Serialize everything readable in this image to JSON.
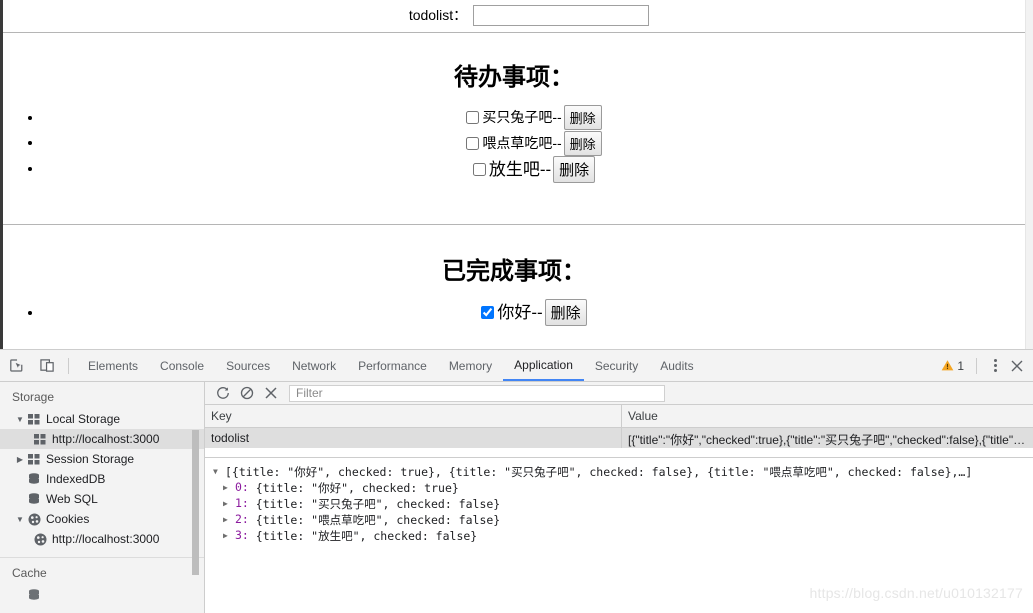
{
  "page": {
    "todolist_label": "todolist：",
    "todolist_input_value": "",
    "todolist_input_placeholder": "",
    "pending": {
      "heading": "待办事项：",
      "items": [
        {
          "title": "买只兔子吧--",
          "delete_label": "删除"
        },
        {
          "title": "喂点草吃吧--",
          "delete_label": "删除"
        },
        {
          "title": "放生吧--",
          "delete_label": "删除"
        }
      ]
    },
    "done": {
      "heading": "已完成事项：",
      "items": [
        {
          "title": "你好--",
          "delete_label": "删除"
        }
      ]
    }
  },
  "devtools": {
    "tabs": [
      {
        "label": "Elements",
        "active": false
      },
      {
        "label": "Console",
        "active": false
      },
      {
        "label": "Sources",
        "active": false
      },
      {
        "label": "Network",
        "active": false
      },
      {
        "label": "Performance",
        "active": false
      },
      {
        "label": "Memory",
        "active": false
      },
      {
        "label": "Application",
        "active": true
      },
      {
        "label": "Security",
        "active": false
      },
      {
        "label": "Audits",
        "active": false
      }
    ],
    "warning_count": "1",
    "sidebar": {
      "storage_label": "Storage",
      "tree": [
        {
          "label": "Local Storage",
          "twisty": "▼",
          "icon": "storage-table-icon",
          "indent": 0,
          "selected": false
        },
        {
          "label": "http://localhost:3000",
          "twisty": "",
          "icon": "storage-table-icon",
          "indent": 1,
          "selected": true
        },
        {
          "label": "Session Storage",
          "twisty": "▶",
          "icon": "storage-table-icon",
          "indent": 0,
          "selected": false
        },
        {
          "label": "IndexedDB",
          "twisty": "",
          "icon": "database-icon",
          "indent": 0,
          "selected": false
        },
        {
          "label": "Web SQL",
          "twisty": "",
          "icon": "database-icon",
          "indent": 0,
          "selected": false
        },
        {
          "label": "Cookies",
          "twisty": "▼",
          "icon": "cookie-icon",
          "indent": 0,
          "selected": false
        },
        {
          "label": "http://localhost:3000",
          "twisty": "",
          "icon": "cookie-icon",
          "indent": 1,
          "selected": false
        }
      ],
      "cache_label": "Cache"
    },
    "toolbar": {
      "refresh_title": "Refresh",
      "clear_title": "Clear All",
      "delete_title": "Delete Selected",
      "filter_placeholder": "Filter"
    },
    "grid": {
      "columns": [
        "Key",
        "Value"
      ],
      "rows": [
        {
          "key": "todolist",
          "value": "[{\"title\":\"你好\",\"checked\":true},{\"title\":\"买只兔子吧\",\"checked\":false},{\"title\":\"…"
        }
      ]
    },
    "preview": {
      "root": "[{title: \"你好\", checked: true}, {title: \"买只兔子吧\", checked: false}, {title: \"喂点草吃吧\", checked: false},…]",
      "root_twisty": "▼",
      "children": [
        {
          "index": "0:",
          "text": " {title: \"你好\", checked: true}",
          "twisty": "▶"
        },
        {
          "index": "1:",
          "text": " {title: \"买只兔子吧\", checked: false}",
          "twisty": "▶"
        },
        {
          "index": "2:",
          "text": " {title: \"喂点草吃吧\", checked: false}",
          "twisty": "▶"
        },
        {
          "index": "3:",
          "text": " {title: \"放生吧\", checked: false}",
          "twisty": "▶"
        }
      ]
    }
  },
  "watermark": "https://blog.csdn.net/u010132177",
  "colors": {
    "accent_blue": "#4285f4",
    "warning_orange": "#f5a623",
    "selected_row": "#dedede",
    "index_purple": "#8b1a9e"
  }
}
